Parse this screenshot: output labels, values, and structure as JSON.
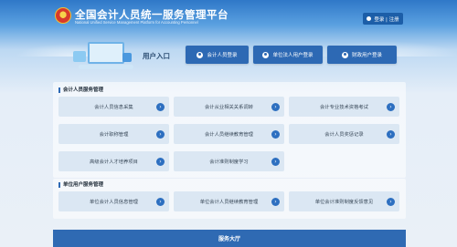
{
  "header": {
    "title": "全国会计人员统一服务管理平台",
    "subtitle": "National Unified Service Management Platform for Accounting Personnel",
    "user_area": "登录 | 注册"
  },
  "portal": {
    "title": "用户入口",
    "entries": [
      {
        "label": "会计人员登录",
        "icon": "user-icon"
      },
      {
        "label": "单位法人用户登录",
        "icon": "user-icon"
      },
      {
        "label": "财政用户登录",
        "icon": "user-icon"
      }
    ]
  },
  "sections": [
    {
      "title": "会计人员服务管理",
      "items": [
        "会计人员信息采集",
        "会计从业相关关系调转",
        "会计专业技术资格考试",
        "会计职称管理",
        "会计人员继续教育管理",
        "会计人员奖惩记录",
        "高级会计人才培养项目",
        "会计准则制度学习"
      ]
    },
    {
      "title": "单位用户服务管理",
      "items": [
        "单位会计人员信息管理",
        "单位会计人员继续教育管理",
        "单位会计准则制度反馈意见"
      ]
    }
  ],
  "footer": {
    "label": "服务大厅"
  },
  "colors": {
    "brand": "#2d69b4",
    "tile": "#dbe7f3",
    "header_bg": "#2f78c8"
  }
}
